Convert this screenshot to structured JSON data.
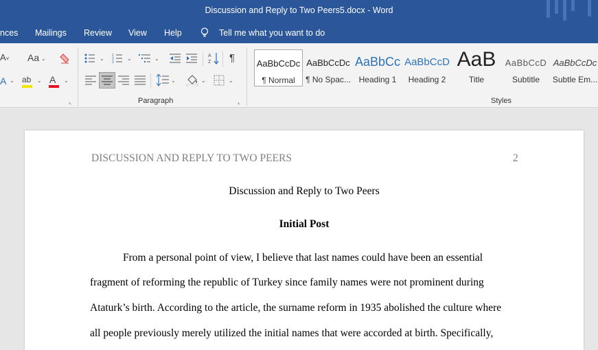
{
  "window": {
    "title": "Discussion and Reply to Two Peers5.docx  -  Word"
  },
  "menu": {
    "items": [
      "nces",
      "Mailings",
      "Review",
      "View",
      "Help"
    ],
    "tell_me": "Tell me what you want to do"
  },
  "ribbon": {
    "paragraph_label": "Paragraph",
    "styles_label": "Styles",
    "styles": [
      {
        "preview": "AaBbCcDc",
        "label": "¶ Normal"
      },
      {
        "preview": "AaBbCcDc",
        "label": "¶ No Spac..."
      },
      {
        "preview": "AaBbCc",
        "label": "Heading 1"
      },
      {
        "preview": "AaBbCcD",
        "label": "Heading 2"
      },
      {
        "preview": "AaB",
        "label": "Title"
      },
      {
        "preview": "AaBbCcD",
        "label": "Subtitle"
      },
      {
        "preview": "AaBbCcDc",
        "label": "Subtle Em..."
      }
    ],
    "font_case_icon": "Aa",
    "icons": [
      "shrink-font-icon",
      "change-case-icon",
      "clear-formatting-icon",
      "text-effects-icon",
      "highlight-icon",
      "font-color-icon",
      "bullets-icon",
      "numbering-icon",
      "multilevel-list-icon",
      "decrease-indent-icon",
      "increase-indent-icon",
      "sort-icon",
      "show-marks-icon",
      "align-left-icon",
      "center-icon",
      "align-right-icon",
      "justify-icon",
      "line-spacing-icon",
      "shading-icon",
      "borders-icon"
    ]
  },
  "document": {
    "running_head": "DISCUSSION AND REPLY TO TWO PEERS",
    "page_number": "2",
    "title": "Discussion and Reply to Two Peers",
    "heading": "Initial Post",
    "lines": [
      "From a personal point of view, I believe that last names could have been an essential",
      "fragment of reforming the republic of Turkey since family names were not prominent during",
      "Ataturk’s birth. According to the article, the surname reform in 1935 abolished the culture where",
      "all people previously merely utilized the initial names that were accorded at birth. Specifically,"
    ]
  }
}
